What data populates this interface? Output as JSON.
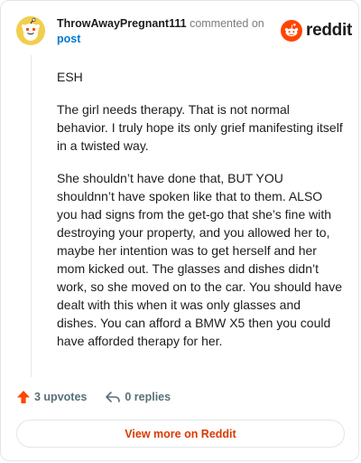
{
  "comment": {
    "username": "ThrowAwayPregnant111",
    "action_text": "commented on",
    "post_link": "post",
    "brand": "reddit",
    "paragraphs": [
      "ESH",
      "The girl needs therapy. That is not normal behavior. I truly hope its only grief manifesting itself in a twisted way.",
      "She shouldn’t have done that, BUT YOU shouldnn’t have spoken like that to them. ALSO you had signs from the get-go that she’s fine with destroying your property, and you allowed her to, maybe her intention was to get herself and her mom kicked out. The glasses and dishes didn’t work, so she moved on to the car. You should have dealt with this when it was only glasses and dishes. You can afford a BMW X5 then you could have afforded therapy for her."
    ],
    "upvotes": "3 upvotes",
    "replies": "0 replies",
    "view_more": "View more on Reddit"
  },
  "colors": {
    "brand_orange": "#ff4500",
    "link_blue": "#0079d3",
    "button_text": "#d93a00"
  },
  "icons": {
    "avatar": "snoo-avatar-icon",
    "logo": "reddit-logo-icon",
    "upvote": "upvote-arrow-icon",
    "reply": "reply-arrow-icon"
  }
}
